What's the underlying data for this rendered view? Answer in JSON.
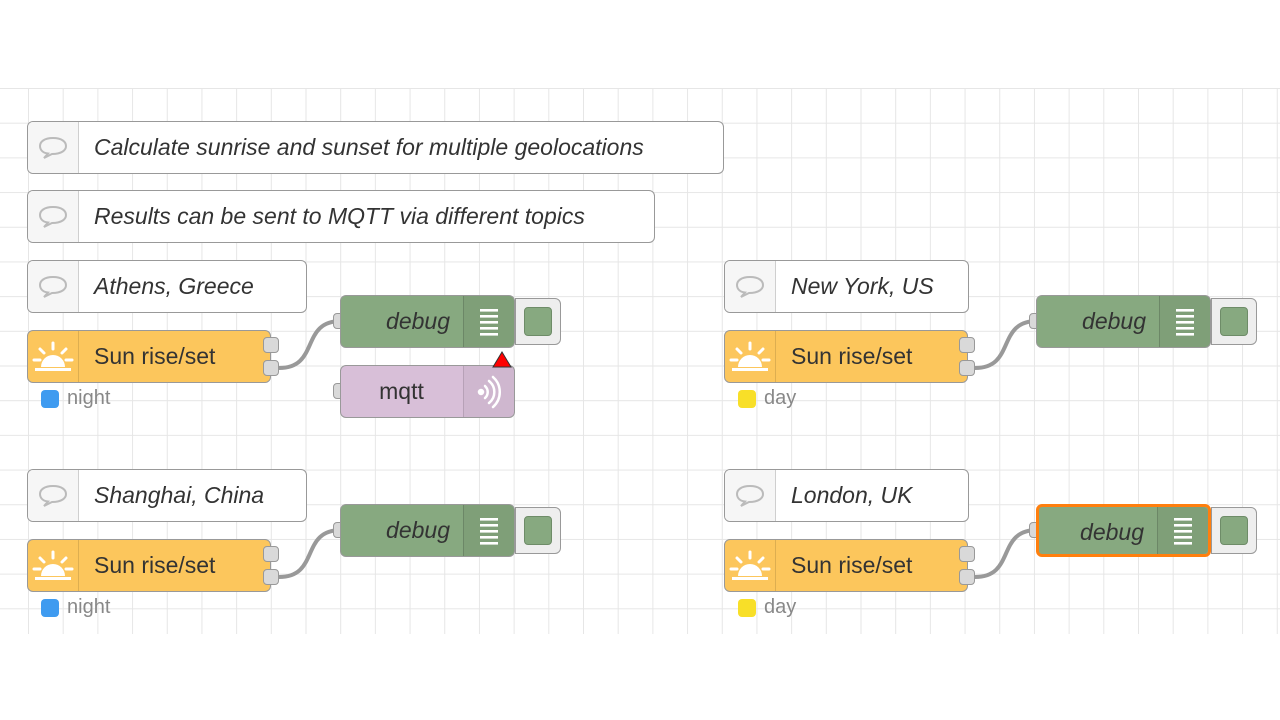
{
  "comments": {
    "title": "Calculate sunrise and sunset for multiple geolocations",
    "subtitle": "Results can be sent to MQTT via different topics",
    "athens": "Athens, Greece",
    "newyork": "New York, US",
    "shanghai": "Shanghai, China",
    "london": "London, UK"
  },
  "sun_label": "Sun rise/set",
  "debug_label": "debug",
  "mqtt_label": "mqtt",
  "status": {
    "athens": "night",
    "newyork": "day",
    "shanghai": "night",
    "london": "day"
  },
  "colors": {
    "sun_node": "#fcc65c",
    "debug_node": "#87a980",
    "mqtt_node": "#d8bfd8",
    "status_night": "#3f9bf0",
    "status_day": "#f8df28",
    "selected_outline": "#ff7f0e",
    "warning": "#ff0000"
  },
  "icons": {
    "comment": "speech-bubble-icon",
    "sun": "sunrise-icon",
    "debug": "debug-list-icon",
    "mqtt": "mqtt-signal-icon",
    "warning": "warning-triangle-icon"
  }
}
